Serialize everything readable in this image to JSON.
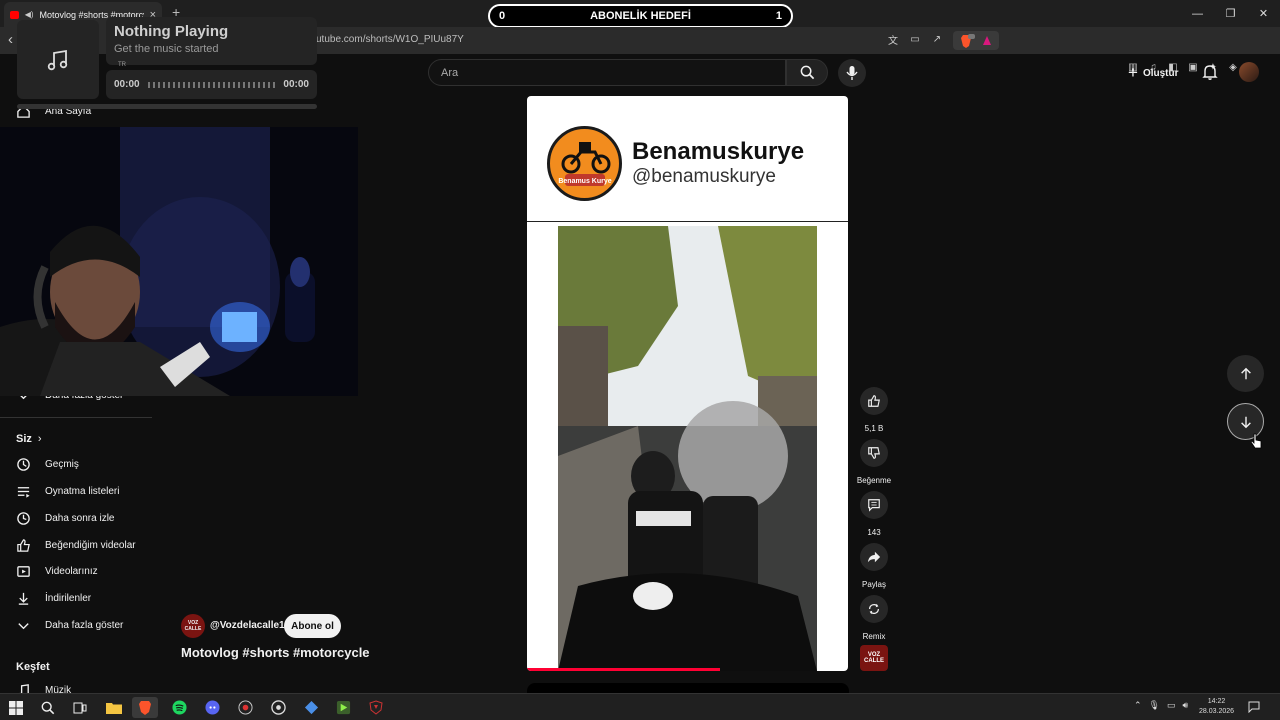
{
  "browser": {
    "tab_title": "Motovlog #shorts #motorcycle",
    "url": "utube.com/shorts/W1O_PIUu87Y",
    "new_tab": "+",
    "close": "×"
  },
  "goal_bar": {
    "label": "ABONELİK HEDEFİ",
    "current": "0",
    "target": "1"
  },
  "music_widget": {
    "title": "Nothing Playing",
    "subtitle": "Get the music started",
    "time_start": "00:00",
    "time_end": "00:00",
    "lang": "TR"
  },
  "header": {
    "search_placeholder": "Ara",
    "create_label": "Oluştur"
  },
  "sidebar": {
    "home": "Ana Sayfa",
    "show_more_top": "Daha fazla göster",
    "you_heading": "Siz",
    "you_items": [
      {
        "label": "Geçmiş",
        "icon": "history-icon"
      },
      {
        "label": "Oynatma listeleri",
        "icon": "playlist-icon"
      },
      {
        "label": "Daha sonra izle",
        "icon": "watch-later-icon"
      },
      {
        "label": "Beğendiğim videolar",
        "icon": "liked-icon"
      },
      {
        "label": "Videolarınız",
        "icon": "your-videos-icon"
      },
      {
        "label": "İndirilenler",
        "icon": "download-icon"
      },
      {
        "label": "Daha fazla göster",
        "icon": "chevron-down-icon"
      }
    ],
    "explore_heading": "Keşfet",
    "explore_items": [
      {
        "label": "Müzik",
        "icon": "music-icon"
      }
    ]
  },
  "video": {
    "card_name": "Benamuskurye",
    "card_handle": "@benamuskurye",
    "logo_text": "Benamus Kurye",
    "progress": 0.6
  },
  "actions": {
    "like_count": "5,1 B",
    "dislike_label": "Beğenme",
    "comment_count": "143",
    "share_label": "Paylaş",
    "remix_label": "Remix"
  },
  "channel": {
    "name": "@Vozdelacalle1",
    "subscribe": "Abone ol",
    "avatar_text": "VOZ CALLE"
  },
  "video_title": "Motovlog #shorts #motorcycle",
  "taskbar": {
    "time": "14:22",
    "date": "28.03.2026"
  },
  "colors": {
    "accent": "#ff0033",
    "background": "#0f0f0f"
  }
}
